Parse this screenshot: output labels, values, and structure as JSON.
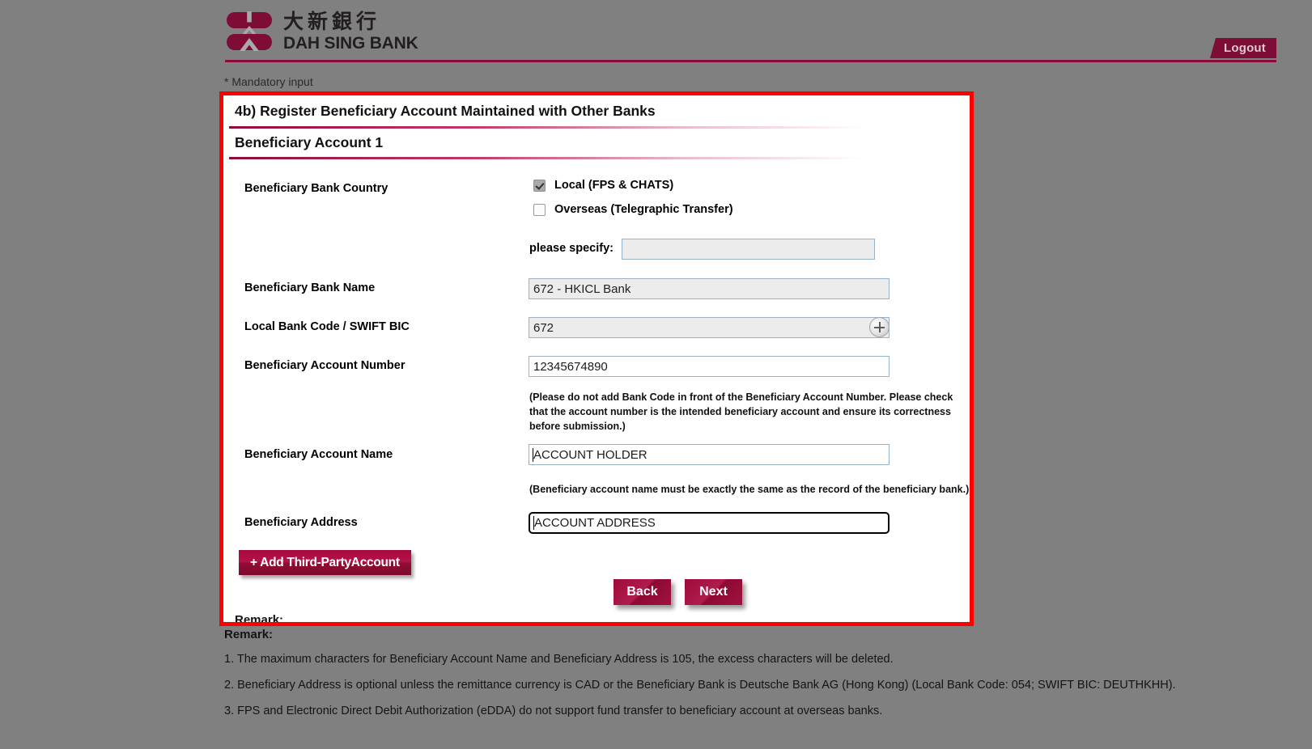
{
  "brand": {
    "logo_cn": "大新銀行",
    "logo_en": "DAH SING BANK",
    "accent": "#8c0b3f",
    "frame_highlight": "#ff0000"
  },
  "header": {
    "logout_label": "Logout"
  },
  "page": {
    "mandatory_note": "* Mandatory input"
  },
  "form": {
    "title": "4b) Register Beneficiary Account Maintained with Other Banks",
    "subtitle": "Beneficiary Account  1",
    "country": {
      "label": "Beneficiary Bank Country",
      "option_local": "Local (FPS & CHATS)",
      "option_overseas": "Overseas (Telegraphic Transfer)",
      "specify_label": "please specify:",
      "specify_value": "",
      "specify_placeholder": ""
    },
    "bank_name": {
      "label": "Beneficiary Bank Name",
      "value": "672 - HKICL Bank"
    },
    "bank_code": {
      "label": "Local Bank Code / SWIFT BIC",
      "value": "672",
      "lookup_icon": "search-plus-icon"
    },
    "account_number": {
      "label": "Beneficiary Account Number",
      "value": "12345674890",
      "note": "(Please do not add Bank Code in front of the Beneficiary Account Number. Please check that the account number is the intended beneficiary account and ensure its correctness before submission.)"
    },
    "account_name": {
      "label": "Beneficiary Account Name",
      "value": "ACCOUNT HOLDER",
      "note": "(Beneficiary account name must be exactly the same as the record of the beneficiary bank.)"
    },
    "address": {
      "label": "Beneficiary Address",
      "value": "ACCOUNT ADDRESS"
    },
    "add_account_label": "+ Add Third-PartyAccount",
    "back_label": "Back",
    "next_label": "Next",
    "remark_clipped": "Remark:"
  },
  "remarks": {
    "title": "Remark:",
    "items": [
      "1. The maximum characters for Beneficiary Account Name and Beneficiary Address is 105, the excess characters will be deleted.",
      "2. Beneficiary Address is optional unless the remittance currency is CAD or the Beneficiary Bank is Deutsche Bank AG (Hong Kong) (Local Bank Code: 054; SWIFT BIC: DEUTHKHH).",
      "3. FPS and Electronic Direct Debit Authorization (eDDA) do not support fund transfer to beneficiary account at overseas banks."
    ]
  }
}
